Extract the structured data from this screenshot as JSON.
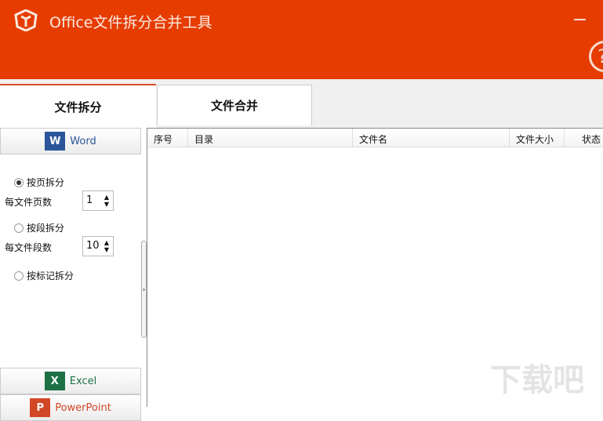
{
  "header": {
    "title": "Office文件拆分合并工具",
    "minimize": "minimize",
    "help": "?"
  },
  "tabs": [
    {
      "label": "文件拆分",
      "active": true
    },
    {
      "label": "文件合并",
      "active": false
    }
  ],
  "left": {
    "word_label": "Word",
    "excel_label": "Excel",
    "ppt_label": "PowerPoint",
    "options": [
      {
        "label": "按页拆分",
        "checked": true
      },
      {
        "label": "按段拆分",
        "checked": false
      },
      {
        "label": "按标记拆分",
        "checked": false
      }
    ],
    "pages_label": "每文件页数",
    "pages_value": "1",
    "paras_label": "每文件段数",
    "paras_value": "10"
  },
  "table": {
    "columns": [
      "序号",
      "目录",
      "文件名",
      "文件大小",
      "状态"
    ]
  },
  "watermark": "下载吧",
  "colors": {
    "brand": "#e63c00"
  }
}
